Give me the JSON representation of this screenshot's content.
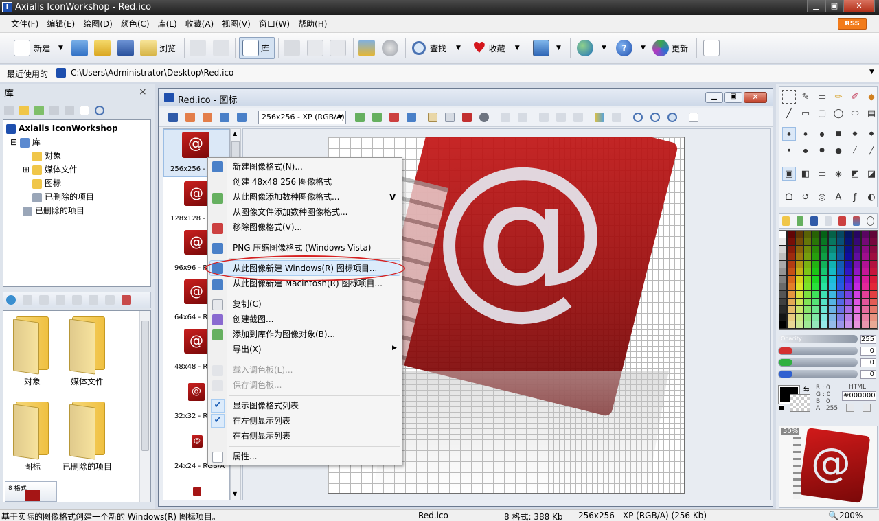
{
  "window": {
    "title": "Axialis IconWorkshop - Red.ico",
    "app_icon_letter": "I"
  },
  "menu": [
    "文件(F)",
    "编辑(E)",
    "绘图(D)",
    "颜色(C)",
    "库(L)",
    "收藏(A)",
    "视图(V)",
    "窗口(W)",
    "帮助(H)"
  ],
  "rss": "RSS",
  "toolbar": {
    "new": "新建",
    "browse": "浏览",
    "library": "库",
    "find": "查找",
    "favorites": "收藏",
    "update": "更新"
  },
  "address": {
    "label": "最近使用的",
    "path": "C:\\Users\\Administrator\\Desktop\\Red.ico"
  },
  "library_panel": {
    "title": "库",
    "tree": [
      "Axialis IconWorkshop",
      "库",
      "对象",
      "媒体文件",
      "图标",
      "已删除的项目",
      "已删除的项目"
    ],
    "folders": [
      "对象",
      "媒体文件",
      "图标",
      "已删除的项目"
    ],
    "partial_item": "8 格式"
  },
  "document": {
    "title": "Red.ico - 图标",
    "format_select": "256x256 - XP (RGB/A)",
    "formats": [
      "256x256 - RG",
      "128x128 - RG",
      "96x96 - RG",
      "64x64 - RG",
      "48x48 - RG",
      "32x32 - RG",
      "24x24 - RGB/A"
    ],
    "at_symbol": "@"
  },
  "context_menu": [
    {
      "label": "新建图像格式(N)...",
      "state": "normal"
    },
    {
      "label": "创建 48x48 256 图像格式",
      "state": "normal"
    },
    {
      "label": "从此图像添加数种图像格式...",
      "state": "normal",
      "shortcut": "V"
    },
    {
      "label": "从图像文件添加数种图像格式...",
      "state": "normal"
    },
    {
      "label": "移除图像格式(V)...",
      "state": "normal"
    },
    {
      "label": "PNG 压缩图像格式 (Windows Vista)",
      "state": "normal"
    },
    {
      "label": "从此图像新建 Windows(R) 图标项目...",
      "state": "highlighted"
    },
    {
      "label": "从此图像新建 Macintosh(R) 图标项目...",
      "state": "normal"
    },
    {
      "label": "复制(C)",
      "state": "normal"
    },
    {
      "label": "创建截图...",
      "state": "normal"
    },
    {
      "label": "添加到库作为图像对象(B)...",
      "state": "normal"
    },
    {
      "label": "导出(X)",
      "state": "normal",
      "submenu": true
    },
    {
      "label": "载入调色板(L)...",
      "state": "disabled"
    },
    {
      "label": "保存调色板...",
      "state": "disabled"
    },
    {
      "label": "显示图像格式列表",
      "state": "checked"
    },
    {
      "label": "在左侧显示列表",
      "state": "checked"
    },
    {
      "label": "在右侧显示列表",
      "state": "normal"
    },
    {
      "label": "属性...",
      "state": "normal"
    }
  ],
  "color_panel": {
    "opacity_label": "Opacity",
    "opacity_value": "255",
    "values": [
      "0",
      "0",
      "0"
    ],
    "rgba": {
      "r": "R :  0",
      "g": "G :  0",
      "b": "B :  0",
      "a": "A : 255"
    },
    "html_label": "HTML:",
    "html_value": "#000000",
    "preview_zoom": "50%"
  },
  "status": {
    "message": "基于实际的图像格式创建一个新的 Windows(R) 图标项目。",
    "file": "Red.ico",
    "formats": "8 格式: 388 Kb",
    "current": "256x256 - XP (RGB/A) (256 Kb)",
    "zoom": "200%"
  },
  "colors": {
    "accent_red": "#b01818",
    "highlight": "#cde4f7",
    "circle": "#d62020"
  }
}
